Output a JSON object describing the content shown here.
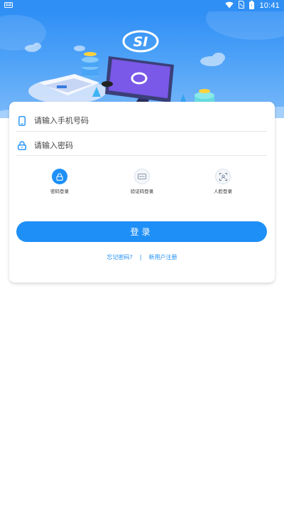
{
  "status_bar": {
    "time": "10:41",
    "icons": [
      "notification-icon",
      "wifi-icon",
      "sim-icon",
      "battery-icon"
    ]
  },
  "banner": {
    "logo_text": "SI"
  },
  "login_form": {
    "phone_placeholder": "请输入手机号码",
    "password_placeholder": "请输入密码",
    "methods": [
      {
        "label": "密码登录",
        "icon": "lock-icon",
        "active": true
      },
      {
        "label": "验证码登录",
        "icon": "sms-code-icon",
        "active": false
      },
      {
        "label": "人脸登录",
        "icon": "face-scan-icon",
        "active": false
      }
    ],
    "login_button": "登录",
    "forgot_password": "忘记密码?",
    "separator": "|",
    "register": "新用户注册"
  },
  "colors": {
    "primary": "#1e8ff7",
    "banner": "#2f8ff5"
  }
}
